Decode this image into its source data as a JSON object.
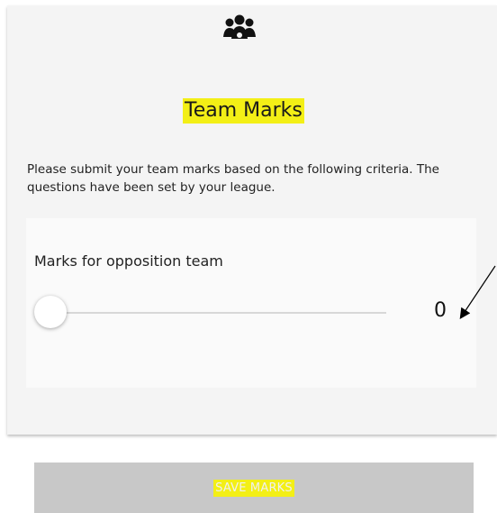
{
  "header": {
    "icon": "team-icon",
    "title": "Team Marks",
    "title_highlight": "#f3ef16"
  },
  "description": "Please submit your team marks based on the following criteria. The questions have been set by your league.",
  "slider": {
    "label": "Marks for opposition team",
    "value": "0"
  },
  "save_button": {
    "label": "SAVE MARKS",
    "background": "#c8c8c8",
    "highlight": "#f3ef16"
  },
  "annotation": {
    "icon": "arrow-annotation-icon"
  }
}
